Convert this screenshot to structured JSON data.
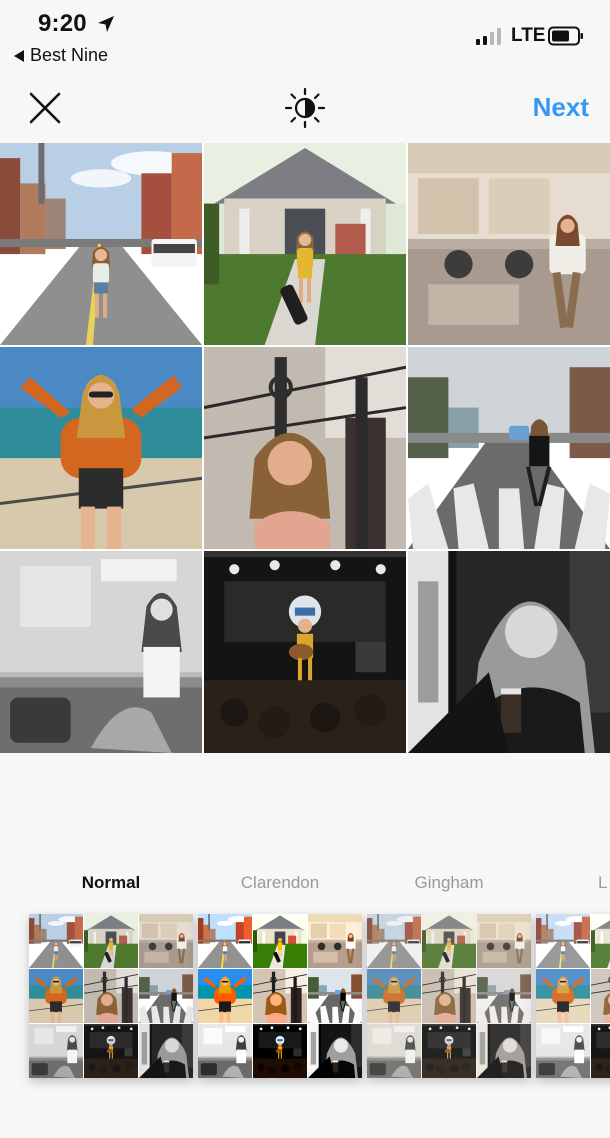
{
  "status_bar": {
    "time": "9:20",
    "back_app": "Best Nine",
    "carrier": "LTE",
    "signal_bars": 4,
    "signal_bars_active": 2
  },
  "nav": {
    "close_icon": "close-x-icon",
    "adjust_icon": "brightness-icon",
    "next_label": "Next",
    "accent_color": "#3897f0"
  },
  "preview": {
    "photos": [
      {
        "scene": "street",
        "name": "photo-street"
      },
      {
        "scene": "house",
        "name": "photo-house"
      },
      {
        "scene": "diner-color",
        "name": "photo-diner"
      },
      {
        "scene": "beach",
        "name": "photo-beach"
      },
      {
        "scene": "fence",
        "name": "photo-fence"
      },
      {
        "scene": "crosswalk",
        "name": "photo-crosswalk"
      },
      {
        "scene": "diner-bw",
        "name": "photo-diner-bw"
      },
      {
        "scene": "stage",
        "name": "photo-stage"
      },
      {
        "scene": "bar-bw",
        "name": "photo-bar-bw"
      }
    ]
  },
  "filters": [
    {
      "label": "Normal",
      "selected": true
    },
    {
      "label": "Clarendon",
      "selected": false
    },
    {
      "label": "Gingham",
      "selected": false
    },
    {
      "label": "L",
      "selected": false
    }
  ]
}
